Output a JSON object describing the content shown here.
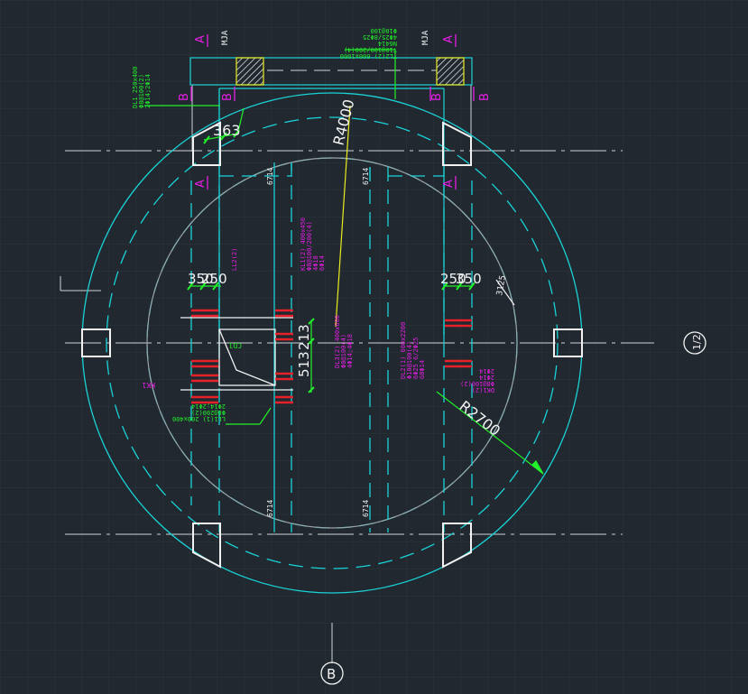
{
  "colors": {
    "background": "#212830",
    "grid": "#2c343d",
    "cyan": "#19d3d6",
    "white": "#f2f2f2",
    "gray": "#9aa3a8",
    "magenta": "#e81ee6",
    "green": "#22f02a",
    "yellow": "#ecec1e",
    "red": "#e8202a"
  },
  "icons": {
    "wall_hatch": "hatched-wall-icon",
    "axis_bubble": "axis-bubble-icon"
  },
  "dimensions": {
    "r4000": "R4000",
    "r2700": "R2700",
    "d363": "363",
    "d350": "350",
    "d250_left": "250",
    "d250_right": "250",
    "d350_right": "350",
    "d213": "213",
    "d513": "513",
    "d3125": "3125"
  },
  "section_marks": {
    "a": "A",
    "b": "B"
  },
  "axis_labels": {
    "right": "1/2",
    "bottom": "B"
  },
  "wall_marks": {
    "left": "MJA",
    "right": "MJA"
  },
  "beam_vertical_labels": {
    "top_left": "6714",
    "top_mid": "6714",
    "bottom_left": "6714",
    "bottom_mid": "6714"
  },
  "annotations": {
    "top_beam": [
      "TL2(2) 600x1000",
      "T10@100/200(4)",
      "N6414",
      "4Φ25/8Φ25",
      "Φ10@100"
    ],
    "left_beam": [
      "DL1 250x400",
      "Φ8@100(2)",
      "2Φ14;2Φ14"
    ],
    "center_left": [
      "LL2(2)"
    ],
    "center_tall": [
      "KL1(2) 400x450",
      "Φ8@100/200(4)",
      "4Φ18",
      "6Φ14"
    ],
    "center_opening": [
      "CD1"
    ],
    "center_opening_b": [
      "KK1"
    ],
    "center_lower": [
      "LL1(1) 200x400",
      "Φ8@200(2)",
      "2Φ14;2Φ14"
    ],
    "middle_right": [
      "DL3(2) 400x600",
      "Φ8@100(4)",
      "4Φ14;4Φ18"
    ],
    "right_beam": [
      "DL2(1) 600x2200",
      "Φ10@100(4)",
      "6Φ25 6/2Φ25",
      "G8Φ14"
    ],
    "right_small": [
      "DK1(2)",
      "Φ8@100(2)",
      "2Φ14",
      "2Φ14"
    ]
  }
}
